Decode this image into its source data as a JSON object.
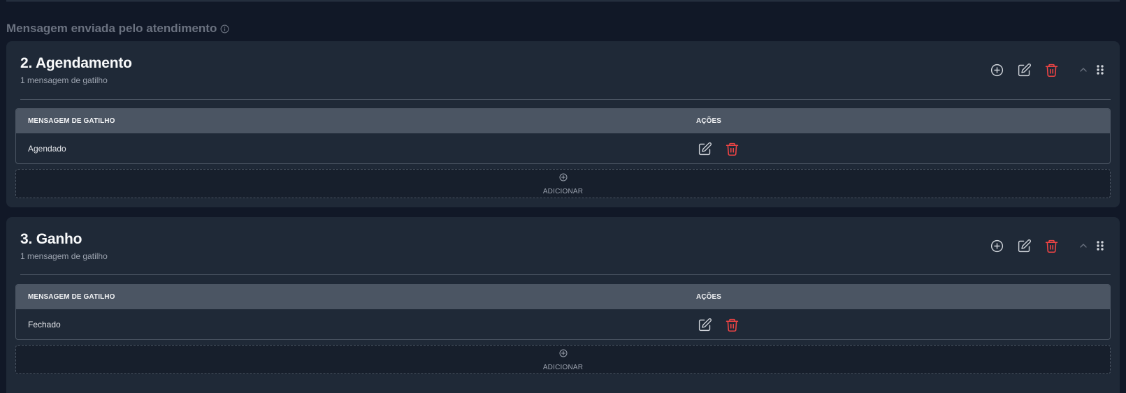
{
  "section": {
    "label": "Mensagem enviada pelo atendimento"
  },
  "stages": [
    {
      "title": "2. Agendamento",
      "subtitle": "1 mensagem de gatilho",
      "table": {
        "col_message": "MENSAGEM DE GATILHO",
        "col_actions": "AÇÕES",
        "rows": [
          {
            "message": "Agendado"
          }
        ]
      },
      "add_label": "ADICIONAR"
    },
    {
      "title": "3. Ganho",
      "subtitle": "1 mensagem de gatilho",
      "table": {
        "col_message": "MENSAGEM DE GATILHO",
        "col_actions": "AÇÕES",
        "rows": [
          {
            "message": "Fechado"
          }
        ]
      },
      "add_label": "ADICIONAR"
    }
  ],
  "icons": {
    "info": "info-icon",
    "add": "plus-circle-icon",
    "edit": "edit-icon",
    "delete": "trash-icon",
    "collapse": "chevron-up-icon",
    "drag": "drag-handle-icon"
  },
  "colors": {
    "background": "#111827",
    "card": "#1f2937",
    "table_header": "#4b5563",
    "danger": "#ef4444",
    "icon": "#d1d5db"
  }
}
